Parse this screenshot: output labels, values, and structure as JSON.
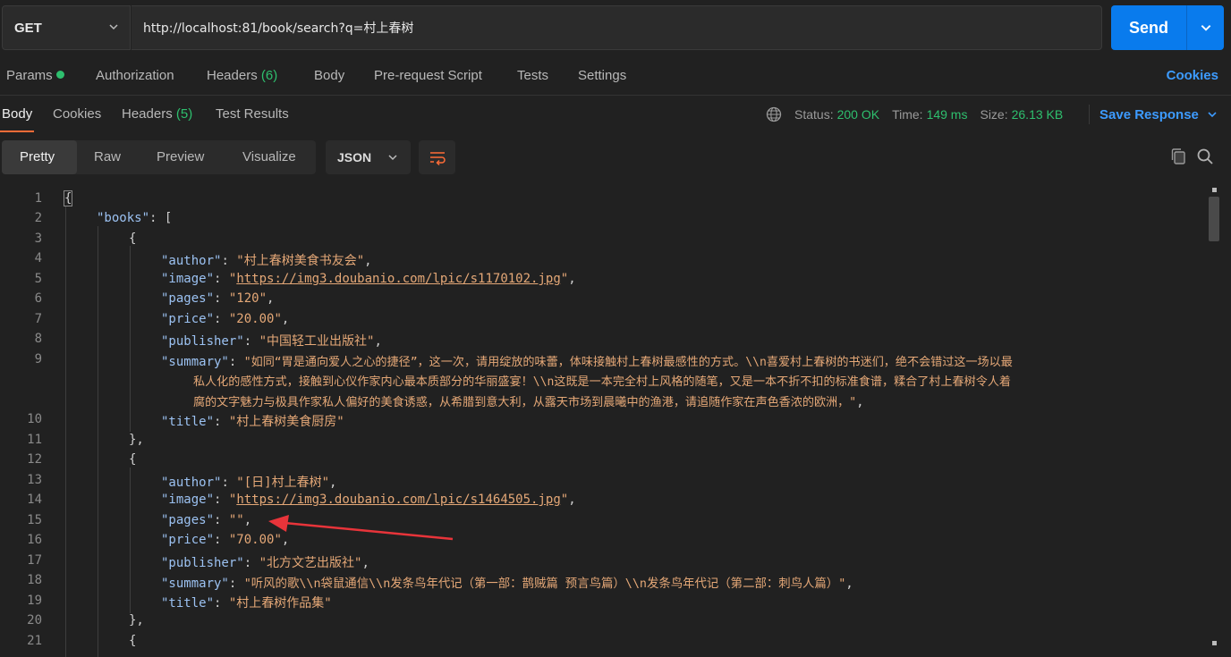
{
  "request": {
    "method": "GET",
    "url": "http://localhost:81/book/search?q=村上春树",
    "send_label": "Send"
  },
  "request_tabs": {
    "params": "Params",
    "authorization": "Authorization",
    "headers": "Headers",
    "headers_count": "(6)",
    "body": "Body",
    "pre_request": "Pre-request Script",
    "tests": "Tests",
    "settings": "Settings",
    "cookies": "Cookies"
  },
  "response_tabs": {
    "body": "Body",
    "cookies": "Cookies",
    "headers": "Headers",
    "headers_count": "(5)",
    "test_results": "Test Results"
  },
  "response_meta": {
    "status_label": "Status:",
    "status_value": "200 OK",
    "time_label": "Time:",
    "time_value": "149 ms",
    "size_label": "Size:",
    "size_value": "26.13 KB",
    "save_response": "Save Response"
  },
  "view": {
    "pretty": "Pretty",
    "raw": "Raw",
    "preview": "Preview",
    "visualize": "Visualize",
    "format": "JSON"
  },
  "editor": {
    "line_numbers": [
      "1",
      "2",
      "3",
      "4",
      "5",
      "6",
      "7",
      "8",
      "9",
      "",
      "",
      "10",
      "11",
      "12",
      "13",
      "14",
      "15",
      "16",
      "17",
      "18",
      "19",
      "20",
      "21"
    ],
    "lines": {
      "l1": "{",
      "l2_key": "\"books\"",
      "l2_rest": ": [",
      "l3": "{",
      "l4_key": "\"author\"",
      "l4_val": "\"村上春树美食书友会\"",
      "l5_key": "\"image\"",
      "l5_q": "\"",
      "l5_url": "https://img3.doubanio.com/lpic/s1170102.jpg",
      "l6_key": "\"pages\"",
      "l6_val": "\"120\"",
      "l7_key": "\"price\"",
      "l7_val": "\"20.00\"",
      "l8_key": "\"publisher\"",
      "l8_val": "\"中国轻工业出版社\"",
      "l9_key": "\"summary\"",
      "l9_val_a": "\"如同“胃是通向爱人之心的捷径”，这一次，请用绽放的味蕾，体味接触村上春树最感性的方式。\\\\n喜爱村上春树的书迷们，绝不会错过这一场以最",
      "l9_val_b": "私人化的感性方式，接触到心仪作家内心最本质部分的华丽盛宴！\\\\n这既是一本完全村上风格的随笔，又是一本不折不扣的标准食谱，糅合了村上春树令人着",
      "l9_val_c": "腐的文字魅力与极具作家私人偏好的美食诱惑，从希腊到意大利，从露天市场到晨曦中的渔港，请追随作家在声色香浓的欧洲，\"",
      "l10_key": "\"title\"",
      "l10_val": "\"村上春树美食厨房\"",
      "l11": "},",
      "l12": "{",
      "l13_key": "\"author\"",
      "l13_val": "\"[日]村上春树\"",
      "l14_key": "\"image\"",
      "l14_q": "\"",
      "l14_url": "https://img3.doubanio.com/lpic/s1464505.jpg",
      "l15_key": "\"pages\"",
      "l15_val": "\"\"",
      "l16_key": "\"price\"",
      "l16_val": "\"70.00\"",
      "l17_key": "\"publisher\"",
      "l17_val": "\"北方文艺出版社\"",
      "l18_key": "\"summary\"",
      "l18_val": "\"听风的歌\\\\n袋鼠通信\\\\n发条鸟年代记（第一部：鹊贼篇 预言鸟篇）\\\\n发条鸟年代记（第二部：刺鸟人篇）\"",
      "l19_key": "\"title\"",
      "l19_val": "\"村上春树作品集\"",
      "l20": "},",
      "l21": "{"
    }
  },
  "colors": {
    "accent": "#097bed",
    "status_green": "#2ebf6e",
    "tab_underline": "#ff6c37",
    "annotation_arrow": "#e8343a"
  }
}
